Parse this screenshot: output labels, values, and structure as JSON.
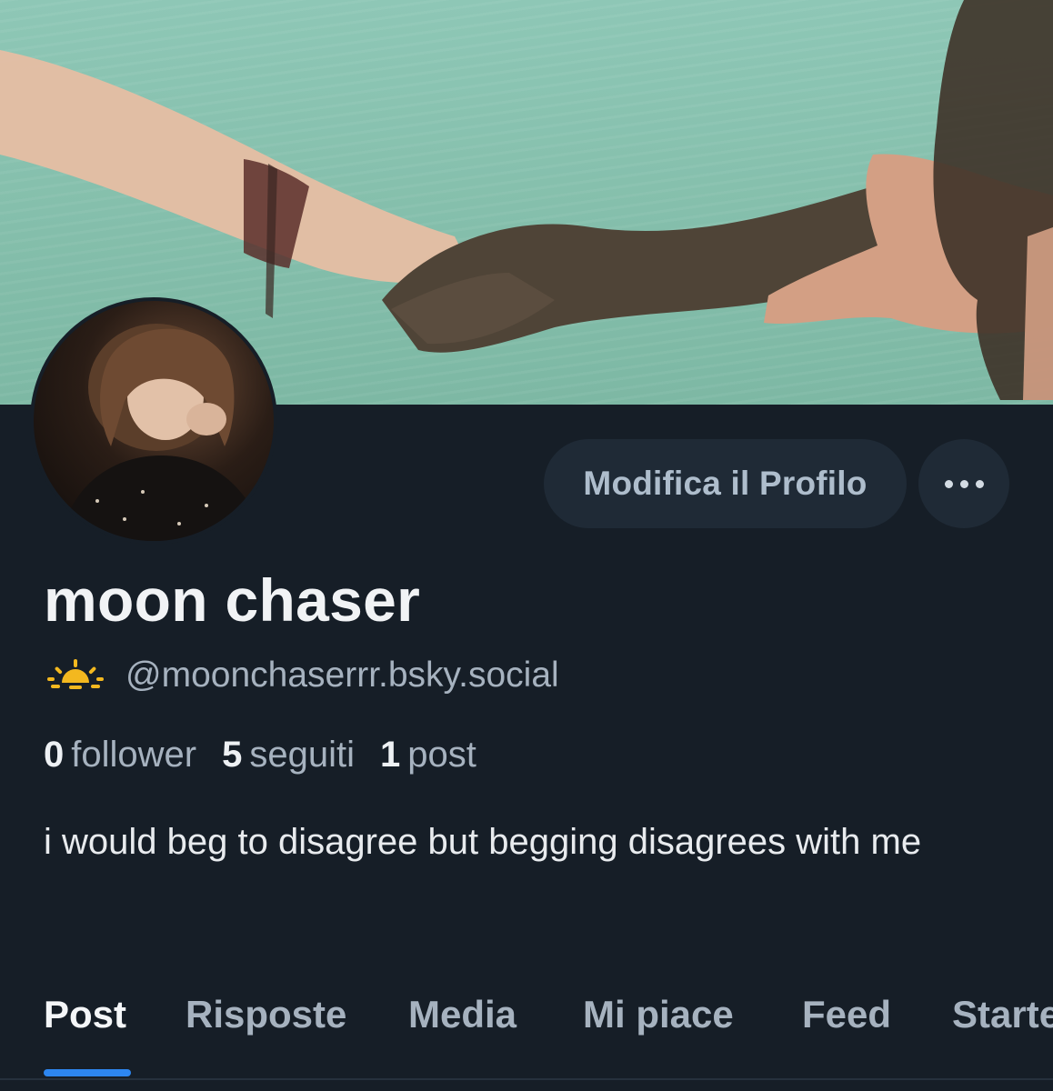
{
  "profile": {
    "display_name": "moon chaser",
    "handle": "@moonchaserrr.bsky.social",
    "bio": "i would beg to disagree but begging disagrees with me",
    "handle_icon": "sun-horizon-emoji"
  },
  "actions": {
    "edit_profile_label": "Modifica il Profilo",
    "more_icon": "ellipsis-icon"
  },
  "stats": [
    {
      "count": "0",
      "label": "follower"
    },
    {
      "count": "5",
      "label": "seguiti"
    },
    {
      "count": "1",
      "label": "post"
    }
  ],
  "tabs": [
    {
      "label": "Post",
      "active": true
    },
    {
      "label": "Risposte",
      "active": false
    },
    {
      "label": "Media",
      "active": false
    },
    {
      "label": "Mi piace",
      "active": false
    },
    {
      "label": "Feed",
      "active": false
    },
    {
      "label": "Starte",
      "active": false
    }
  ],
  "colors": {
    "background": "#161e27",
    "button_bg": "#1f2a36",
    "accent": "#2d86f0",
    "muted_text": "#a6b2bf",
    "sun_emoji": "#f3b81f"
  }
}
